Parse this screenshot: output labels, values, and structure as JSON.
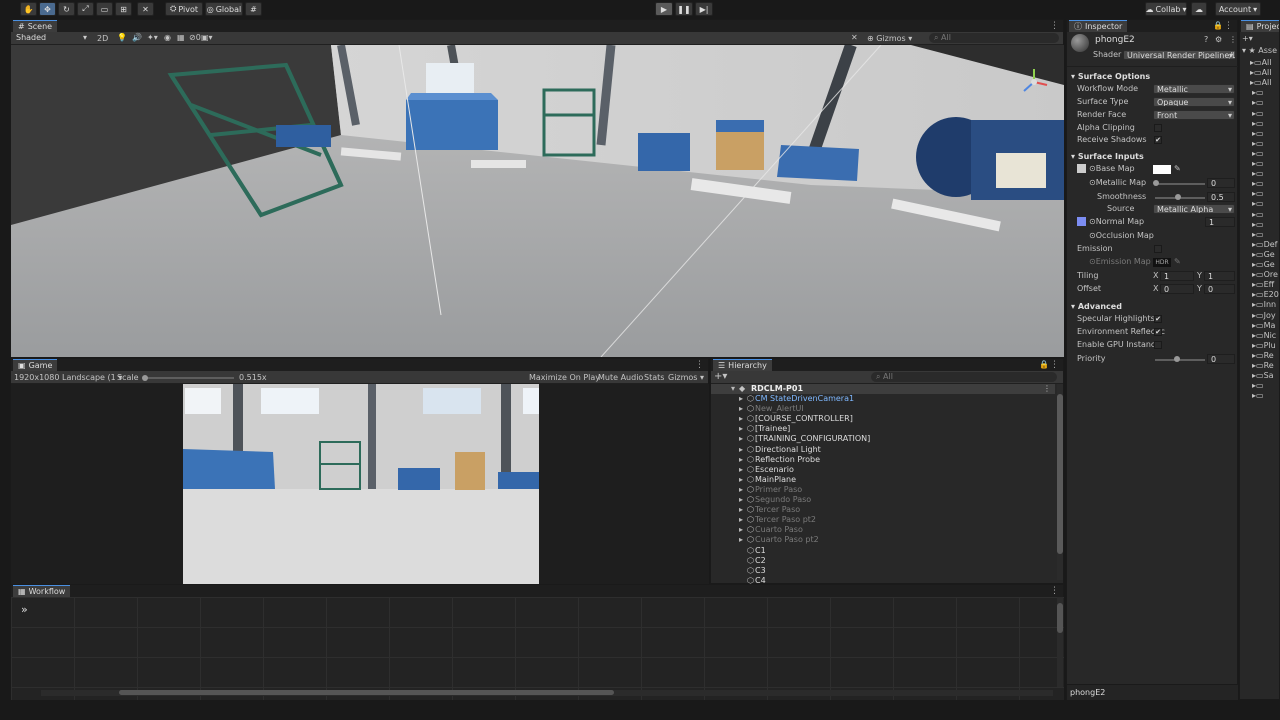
{
  "toolbar": {
    "pivot": "Pivot",
    "global": "Global",
    "collab": "Collab",
    "account": "Account"
  },
  "scene": {
    "tab": "Scene",
    "shading": "Shaded",
    "mode_2d": "2D",
    "gizmo_count": "0",
    "gizmos": "Gizmos",
    "search_placeholder": "All"
  },
  "game": {
    "tab": "Game",
    "resolution": "1920x1080 Landscape (1",
    "scale_label": "Scale",
    "scale_value": "0.515x",
    "maximize": "Maximize On Play",
    "mute": "Mute Audio",
    "stats": "Stats",
    "gizmos": "Gizmos"
  },
  "hierarchy": {
    "tab": "Hierarchy",
    "search_placeholder": "All",
    "root": "RDCLM-P01",
    "items": [
      {
        "label": "CM StateDrivenCamera1",
        "state": "blue"
      },
      {
        "label": "New_AlertUI",
        "state": "grey"
      },
      {
        "label": "[COURSE_CONTROLLER]",
        "state": "normal"
      },
      {
        "label": "[Trainee]",
        "state": "normal"
      },
      {
        "label": "[TRAINING_CONFIGURATION]",
        "state": "normal"
      },
      {
        "label": "Directional Light",
        "state": "normal"
      },
      {
        "label": "Reflection Probe",
        "state": "normal"
      },
      {
        "label": "Escenario",
        "state": "normal"
      },
      {
        "label": "MainPlane",
        "state": "normal"
      },
      {
        "label": "Primer Paso",
        "state": "grey"
      },
      {
        "label": "Segundo Paso",
        "state": "grey"
      },
      {
        "label": "Tercer Paso",
        "state": "grey"
      },
      {
        "label": "Tercer Paso pt2",
        "state": "grey"
      },
      {
        "label": "Cuarto Paso",
        "state": "grey"
      },
      {
        "label": "Cuarto Paso pt2",
        "state": "grey"
      },
      {
        "label": "C1",
        "state": "normal"
      },
      {
        "label": "C2",
        "state": "normal"
      },
      {
        "label": "C3",
        "state": "normal"
      },
      {
        "label": "C4",
        "state": "normal"
      }
    ]
  },
  "workflow": {
    "tab": "Workflow"
  },
  "inspector": {
    "tab": "Inspector",
    "material_name": "phongE2",
    "shader_label": "Shader",
    "shader_value": "Universal Render Pipeline/Li",
    "surface_options": "Surface Options",
    "workflow_mode_label": "Workflow Mode",
    "workflow_mode_value": "Metallic",
    "surface_type_label": "Surface Type",
    "surface_type_value": "Opaque",
    "render_face_label": "Render Face",
    "render_face_value": "Front",
    "alpha_clipping": "Alpha Clipping",
    "receive_shadows": "Receive Shadows",
    "surface_inputs": "Surface Inputs",
    "base_map": "Base Map",
    "metallic_map": "Metallic Map",
    "metallic_value": "0",
    "smoothness": "Smoothness",
    "smoothness_value": "0.5",
    "source_label": "Source",
    "source_value": "Metallic Alpha",
    "normal_map": "Normal Map",
    "normal_value": "1",
    "occlusion_map": "Occlusion Map",
    "emission": "Emission",
    "emission_map": "Emission Map",
    "hdr": "HDR",
    "tiling": "Tiling",
    "offset": "Offset",
    "x_label": "X",
    "y_label": "Y",
    "tiling_x": "1",
    "tiling_y": "1",
    "offset_x": "0",
    "offset_y": "0",
    "advanced": "Advanced",
    "specular": "Specular Highlights",
    "env_reflections": "Environment Reflectic",
    "gpu_instancing": "Enable GPU Instancin",
    "priority": "Priority",
    "priority_value": "0",
    "footer": "phongE2"
  },
  "project": {
    "tab": "Project",
    "assets": "Asse",
    "folders": [
      "All",
      "All",
      "All",
      "",
      "",
      "",
      "",
      "",
      "",
      "",
      "",
      "",
      "",
      "",
      "",
      "",
      "",
      "",
      "Def",
      "Ge",
      "Ge",
      "Ore",
      "Eff",
      "E20",
      "Inn",
      "Joy",
      "Ma",
      "Nic",
      "Plu",
      "Re",
      "Re",
      "Sa",
      "",
      ""
    ]
  }
}
